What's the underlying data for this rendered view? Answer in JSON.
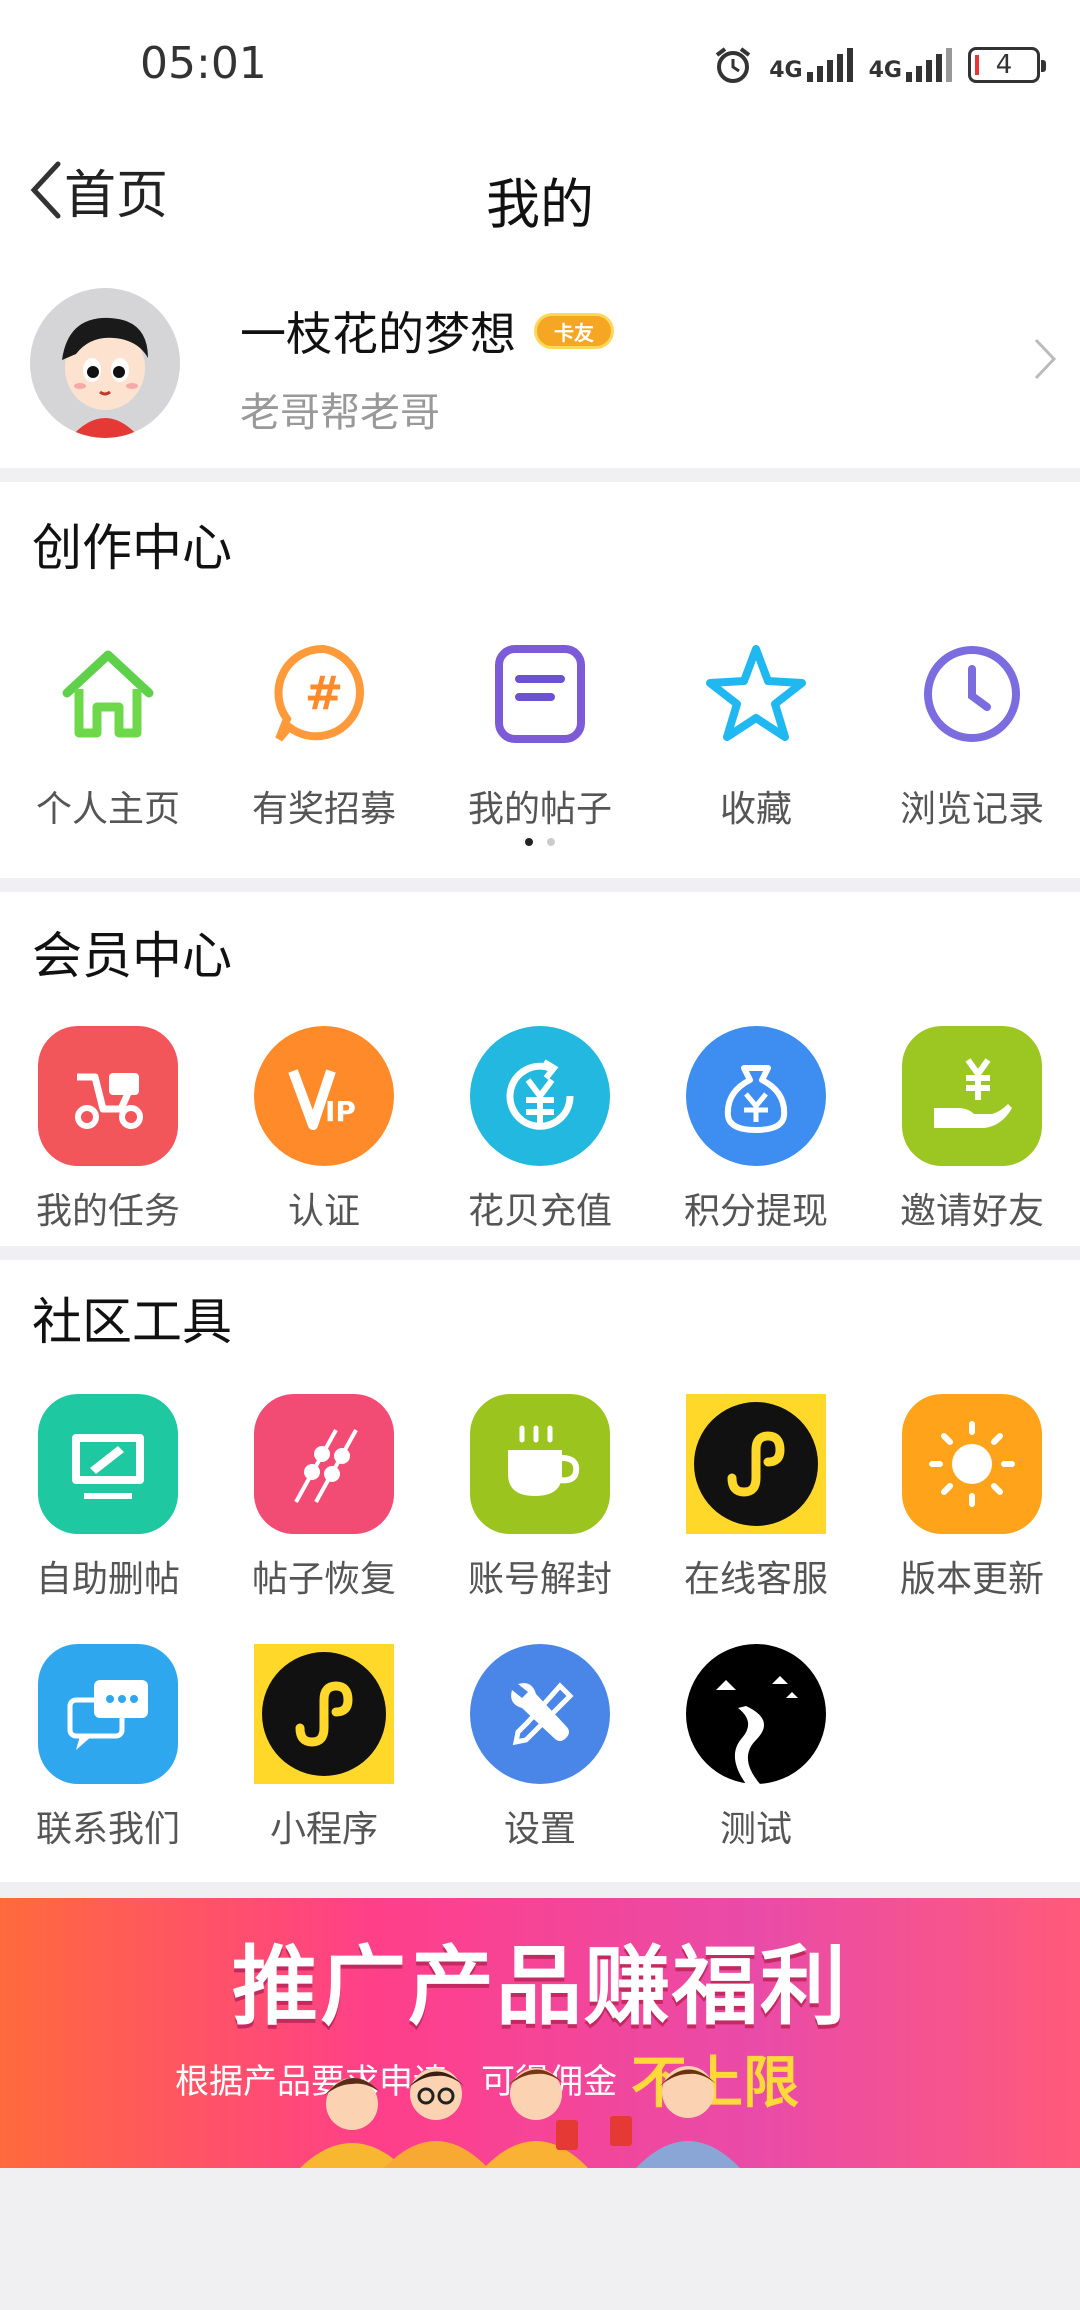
{
  "status_bar": {
    "time": "05:01",
    "signal1": "4G",
    "signal2": "4G",
    "battery": "4"
  },
  "nav": {
    "back_label": "首页",
    "title": "我的"
  },
  "profile": {
    "name": "一枝花的梦想",
    "badge": "卡友",
    "subtitle": "老哥帮老哥"
  },
  "creation_center": {
    "title": "创作中心",
    "items": [
      {
        "label": "个人主页",
        "icon": "home-icon"
      },
      {
        "label": "有奖招募",
        "icon": "hashtag-chat-icon"
      },
      {
        "label": "我的帖子",
        "icon": "document-icon"
      },
      {
        "label": "收藏",
        "icon": "star-icon"
      },
      {
        "label": "浏览记录",
        "icon": "clock-icon"
      }
    ],
    "page_count": 2,
    "current_page": 1
  },
  "member_center": {
    "title": "会员中心",
    "items": [
      {
        "label": "我的任务",
        "icon": "scooter-icon",
        "color": "#f2555a"
      },
      {
        "label": "认证",
        "icon": "vip-icon",
        "color": "#ff8a2a"
      },
      {
        "label": "花贝充值",
        "icon": "yen-circle-icon",
        "color": "#22b8e0"
      },
      {
        "label": "积分提现",
        "icon": "money-bag-icon",
        "color": "#3d8ef0"
      },
      {
        "label": "邀请好友",
        "icon": "hand-yen-icon",
        "color": "#9cc621"
      }
    ]
  },
  "community_tools": {
    "title": "社区工具",
    "items": [
      {
        "label": "自助删帖",
        "icon": "monitor-edit-icon",
        "color": "#1ec8a0"
      },
      {
        "label": "帖子恢复",
        "icon": "skewers-icon",
        "color": "#f24c75"
      },
      {
        "label": "账号解封",
        "icon": "cup-icon",
        "color": "#9bc41e"
      },
      {
        "label": "在线客服",
        "icon": "mini-program-icon",
        "color": "#ffd82a"
      },
      {
        "label": "版本更新",
        "icon": "sun-icon",
        "color": "#ffa41a"
      },
      {
        "label": "联系我们",
        "icon": "chat-bubbles-icon",
        "color": "#2ea7ef"
      },
      {
        "label": "小程序",
        "icon": "mini-program-icon",
        "color": "#ffd82a"
      },
      {
        "label": "设置",
        "icon": "wrench-screwdriver-icon",
        "color": "#4a86e8"
      },
      {
        "label": "测试",
        "icon": "night-road-icon",
        "color": "#000000"
      }
    ]
  },
  "banner": {
    "title": "推广产品赚福利",
    "subtitle": "根据产品要求申请，可得佣金",
    "highlight": "不上限"
  }
}
